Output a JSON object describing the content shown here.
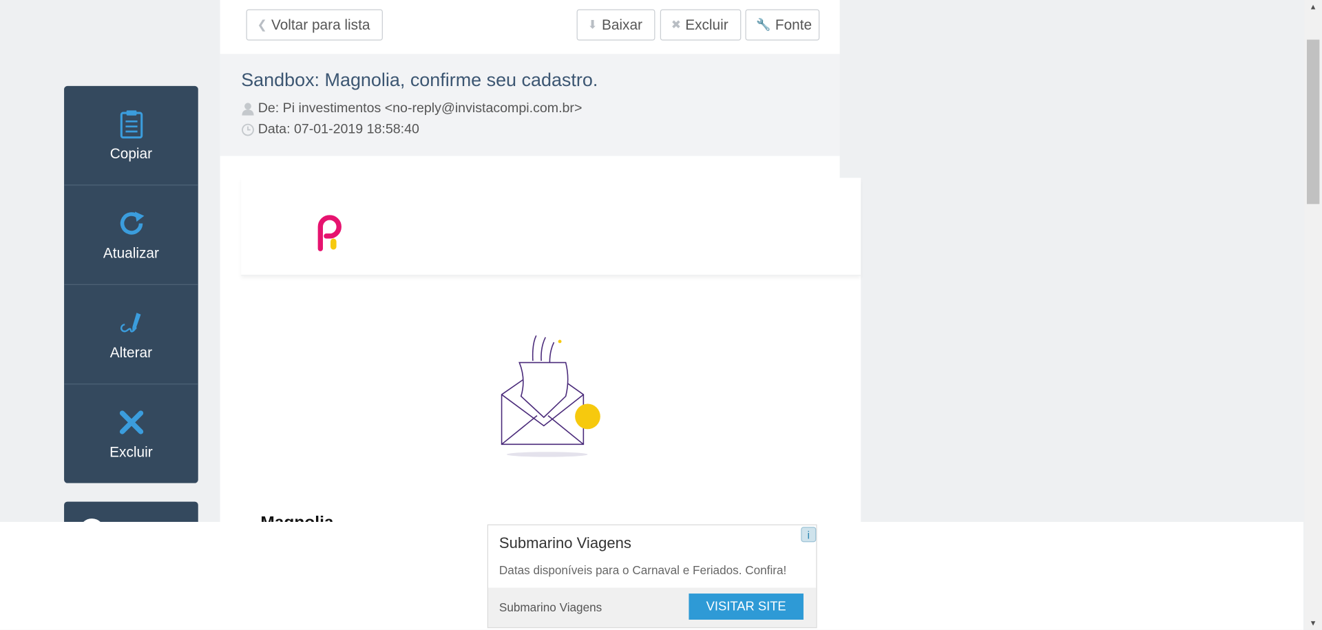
{
  "toolbar": {
    "back_label": "Voltar para lista",
    "download_label": "Baixar",
    "delete_label": "Excluir",
    "source_label": "Fonte"
  },
  "message": {
    "subject": "Sandbox: Magnolia, confirme seu cadastro.",
    "from": "De: Pi investimentos <no-reply@invistacompi.com.br>",
    "date": "Data: 07-01-2019 18:58:40",
    "greeting": "Magnolia,"
  },
  "sidebar": {
    "items": [
      {
        "label": "Copiar",
        "icon": "clipboard-icon"
      },
      {
        "label": "Atualizar",
        "icon": "refresh-icon"
      },
      {
        "label": "Alterar",
        "icon": "edit-signature-icon"
      },
      {
        "label": "Excluir",
        "icon": "close-icon"
      }
    ]
  },
  "ad": {
    "title": "Submarino Viagens",
    "description": "Datas disponíveis para o Carnaval e Feriados. Confira!",
    "advertiser": "Submarino Viagens",
    "cta": "VISITAR SITE",
    "info": "i"
  },
  "colors": {
    "sidebar_bg": "#34495e",
    "icon_blue": "#3b9ddd",
    "subject_color": "#3c5672",
    "brand_pink": "#e6136f",
    "brand_yellow": "#f6c90e",
    "cta_blue": "#2e9ad6"
  }
}
